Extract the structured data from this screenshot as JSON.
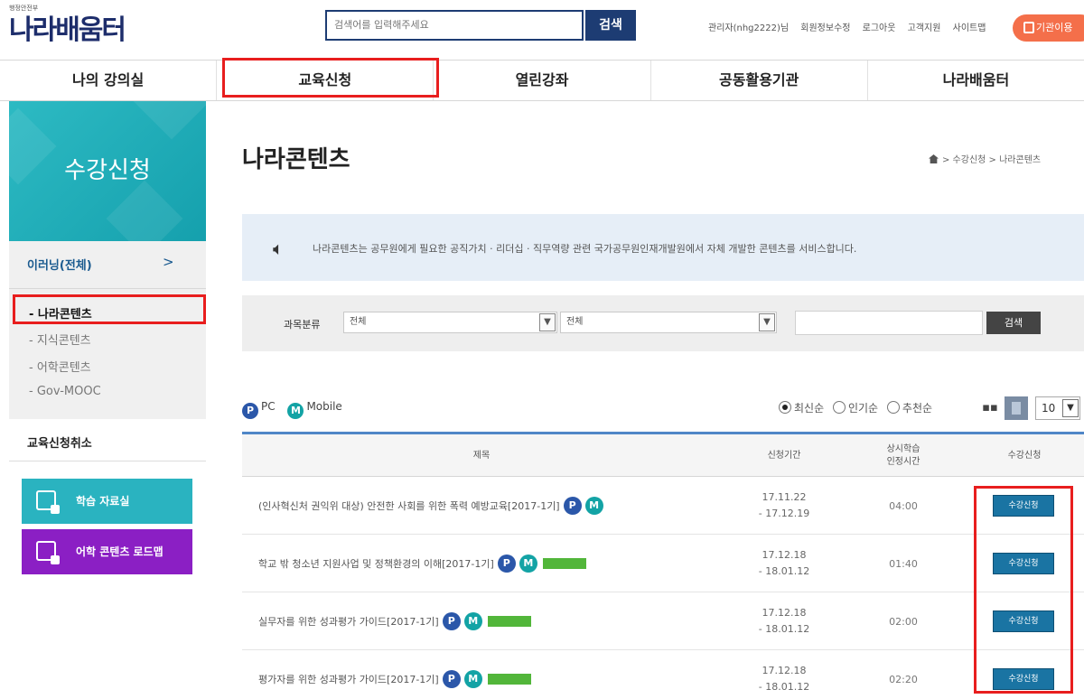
{
  "header": {
    "logo_sub": "행정안전부",
    "logo": "나라배움터",
    "search_placeholder": "검색어를 입력해주세요",
    "search_button": "검색",
    "util_links": [
      "관리자(nhg2222)님",
      "회원정보수정",
      "로그아웃",
      "고객지원",
      "사이트맵"
    ],
    "app_button": "기관이용"
  },
  "gnb": [
    "나의 강의실",
    "교육신청",
    "열린강좌",
    "공동활용기관",
    "나라배움터"
  ],
  "sidebar": {
    "hero_title": "수강신청",
    "category": "이러닝(전체)",
    "category_arrow": ">",
    "items": [
      "- 나라콘텐츠",
      "- 지식콘텐츠",
      "- 어학콘텐츠",
      "- Gov-MOOC"
    ],
    "cancel": "교육신청취소",
    "btn_materials": "학습 자료실",
    "btn_language": "어학 콘텐츠 로드맵"
  },
  "content": {
    "title": "나라콘텐츠",
    "breadcrumb": "> 수강신청 > 나라콘텐츠",
    "notice": "나라콘텐츠는 공무원에게 필요한 공직가치 · 리더십 · 직무역량 관련 국가공무원인재개발원에서 자체 개발한 콘텐츠를 서비스합니다.",
    "filter": {
      "label": "과목분류",
      "select1": "전체",
      "select2": "전체",
      "search_button": "검색"
    },
    "legend": {
      "pc": "PC",
      "mobile": "Mobile",
      "pc_glyph": "P",
      "m_glyph": "M"
    },
    "sort": {
      "options": [
        "최신순",
        "인기순",
        "추천순"
      ],
      "selected": 0
    },
    "per_page": "10",
    "columns": [
      "제목",
      "신청기간",
      "상시학습\n인정시간",
      "수강신청"
    ],
    "rows": [
      {
        "title": "(인사혁신처 권익위 대상) 안전한 사회를 위한 폭력 예방교육[2017-1기]",
        "start": "17.11.22",
        "end": "- 17.12.19",
        "time": "04:00",
        "action": "수강신청",
        "badge": false
      },
      {
        "title": "학교 밖 청소년 지원사업 및 정책환경의 이해[2017-1기]",
        "start": "17.12.18",
        "end": "- 18.01.12",
        "time": "01:40",
        "action": "수강신청",
        "badge": true
      },
      {
        "title": "실무자를 위한 성과평가 가이드[2017-1기]",
        "start": "17.12.18",
        "end": "- 18.01.12",
        "time": "02:00",
        "action": "수강신청",
        "badge": true
      },
      {
        "title": "평가자를 위한 성과평가 가이드[2017-1기]",
        "start": "17.12.18",
        "end": "- 18.01.12",
        "time": "02:20",
        "action": "수강신청",
        "badge": true
      }
    ]
  },
  "colors": {
    "navy": "#1d3c73",
    "teal": "#13a3a5",
    "purple": "#8b1fc4",
    "highlight": "#e81e1e"
  }
}
